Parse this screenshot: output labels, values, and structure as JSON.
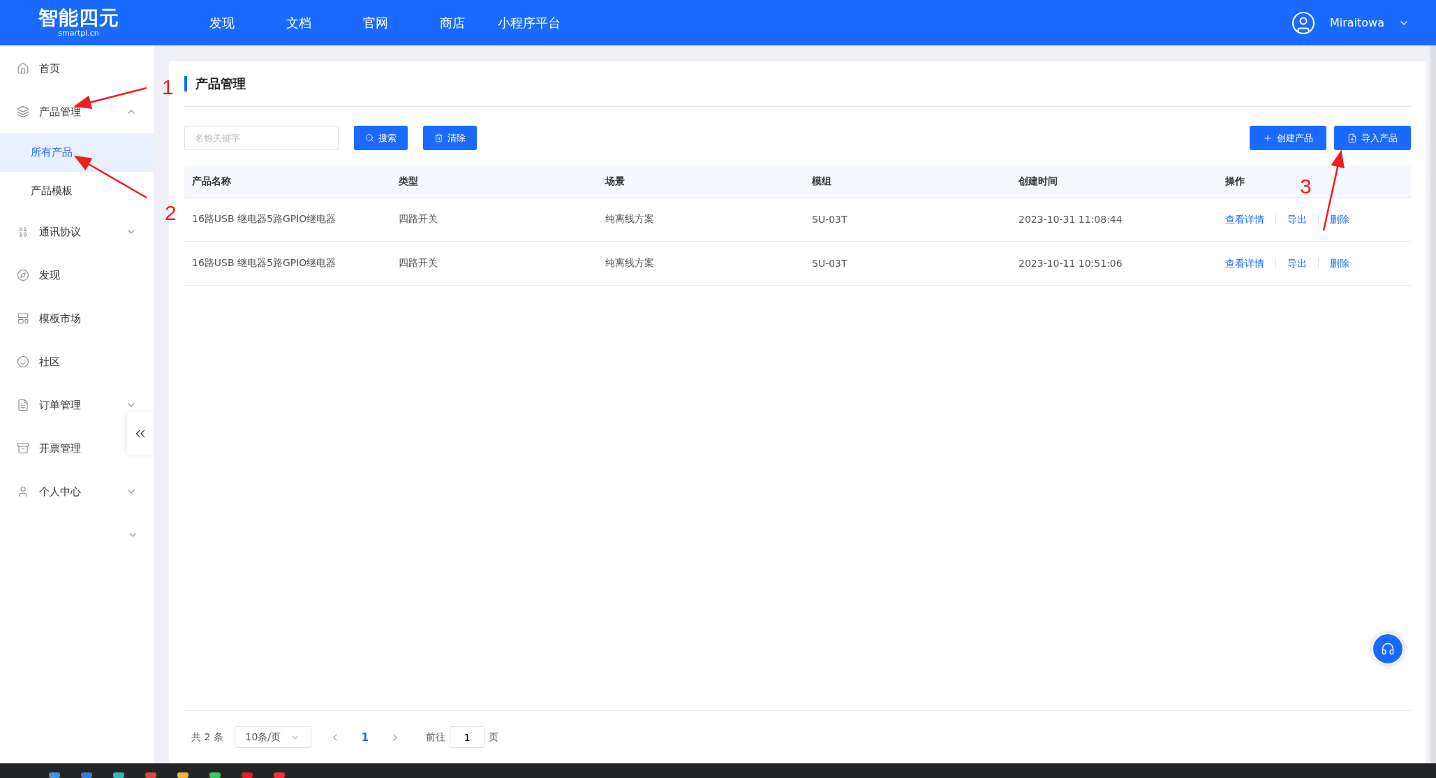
{
  "header": {
    "logo": {
      "name": "智能四元",
      "domain": "smartpi.cn"
    },
    "nav": [
      {
        "label": "发现"
      },
      {
        "label": "文档"
      },
      {
        "label": "官网"
      },
      {
        "label": "商店"
      },
      {
        "label": "小程序平台"
      }
    ],
    "user": {
      "name": "Miraitowa"
    }
  },
  "sidebar": {
    "items": [
      {
        "kind": "item",
        "label": "首页"
      },
      {
        "kind": "group",
        "label": "产品管理",
        "expanded": true,
        "children": [
          {
            "label": "所有产品",
            "selected": true
          },
          {
            "label": "产品模板",
            "selected": false
          }
        ]
      },
      {
        "kind": "group",
        "label": "通讯协议",
        "expanded": false
      },
      {
        "kind": "item",
        "label": "发现"
      },
      {
        "kind": "item",
        "label": "模板市场"
      },
      {
        "kind": "item",
        "label": "社区"
      },
      {
        "kind": "group",
        "label": "订单管理",
        "expanded": false
      },
      {
        "kind": "item",
        "label": "开票管理"
      },
      {
        "kind": "group",
        "label": "个人中心",
        "expanded": false
      },
      {
        "kind": "chevron",
        "expanded": false
      }
    ]
  },
  "page": {
    "title": "产品管理",
    "search": {
      "placeholder": "名称关键字"
    },
    "buttons": [
      {
        "label": "搜索"
      },
      {
        "label": "清除"
      }
    ],
    "actions": [
      {
        "label": "创建产品"
      },
      {
        "label": "导入产品"
      }
    ],
    "table": {
      "columns": [
        "产品名称",
        "类型",
        "场景",
        "模组",
        "创建时间",
        "操作"
      ],
      "rows": [
        {
          "cells": [
            "16路USB 继电器5路GPIO继电器",
            "四路开关",
            "纯离线方案",
            "SU-03T",
            "2023-10-31 11:08:44"
          ],
          "links": [
            "查看详情",
            "导出",
            "删除"
          ]
        },
        {
          "cells": [
            "16路USB 继电器5路GPIO继电器",
            "四路开关",
            "纯离线方案",
            "SU-03T",
            "2023-10-11 10:51:06"
          ],
          "links": [
            "查看详情",
            "导出",
            "删除"
          ]
        }
      ]
    },
    "pagination": {
      "total": "共 2 条",
      "page_size": "10条/页",
      "pages": [
        {
          "label": "1",
          "selected": true
        }
      ],
      "goto_label": "前往",
      "goto_value": "1",
      "goto_suffix": "页"
    }
  },
  "annotations": [
    {
      "label": "1"
    },
    {
      "label": "2"
    },
    {
      "label": "3"
    }
  ]
}
